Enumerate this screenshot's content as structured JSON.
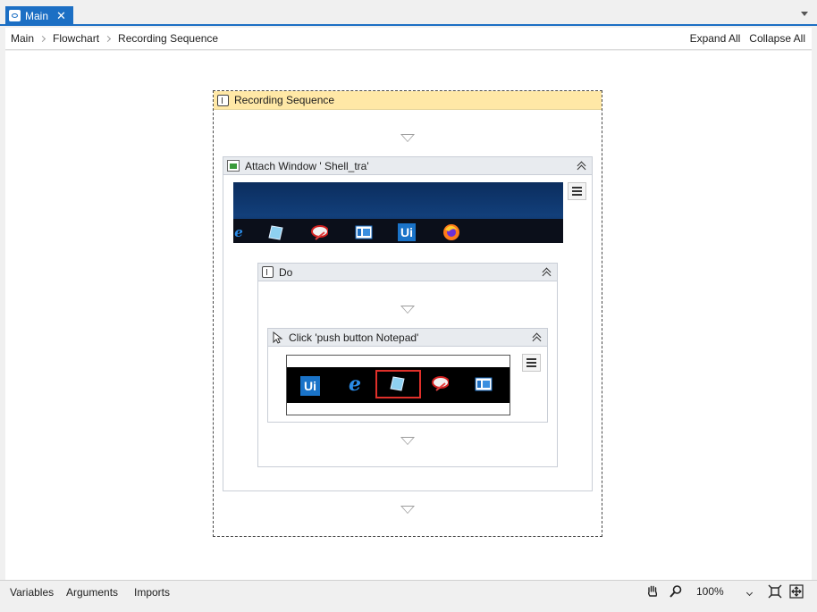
{
  "tab": {
    "label": "Main",
    "close": "✕"
  },
  "breadcrumb": {
    "items": [
      "Main",
      "Flowchart",
      "Recording Sequence"
    ]
  },
  "actions": {
    "expand_all": "Expand All",
    "collapse_all": "Collapse All"
  },
  "sequence": {
    "title": "Recording Sequence"
  },
  "attach_window": {
    "title": "Attach Window ' Shell_tra'"
  },
  "do_block": {
    "title": "Do"
  },
  "click": {
    "title": "Click 'push button  Notepad'"
  },
  "taskbar_icons": {
    "ie": "e",
    "uipath": "Ui"
  },
  "status": {
    "variables": "Variables",
    "arguments": "Arguments",
    "imports": "Imports",
    "zoom": "100%"
  },
  "colors": {
    "accent": "#1c6fc4",
    "sequence_header": "#ffe8a6",
    "highlight": "#e0302a"
  }
}
